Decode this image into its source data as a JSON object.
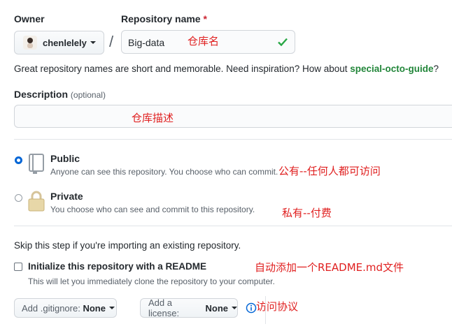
{
  "owner": {
    "label": "Owner",
    "value": "chenlelely"
  },
  "repo": {
    "label": "Repository name",
    "required_mark": "*",
    "value": "Big-data",
    "note": "仓库名"
  },
  "suggestion": {
    "text": "Great repository names are short and memorable. Need inspiration? How about ",
    "name": "special-octo-guide",
    "suffix": "?"
  },
  "description": {
    "label": "Description",
    "optional": "(optional)",
    "note": "仓库描述"
  },
  "visibility": {
    "public": {
      "title": "Public",
      "desc": "Anyone can see this repository. You choose who can commit.",
      "note": "公有--任何人都可访问",
      "selected": true
    },
    "private": {
      "title": "Private",
      "desc": "You choose who can see and commit to this repository.",
      "note": "私有--付费",
      "selected": false
    }
  },
  "skip_text": "Skip this step if you're importing an existing repository.",
  "readme": {
    "label": "Initialize this repository with a README",
    "desc": "This will let you immediately clone the repository to your computer.",
    "note": "自动添加一个README.md文件",
    "checked": false
  },
  "gitignore": {
    "prefix": "Add .gitignore:",
    "value": "None"
  },
  "license": {
    "prefix": "Add a license:",
    "value": "None",
    "note": "访问协议"
  },
  "colors": {
    "accent": "#0366d6",
    "link_green": "#22863a",
    "note_red": "#e02020"
  }
}
